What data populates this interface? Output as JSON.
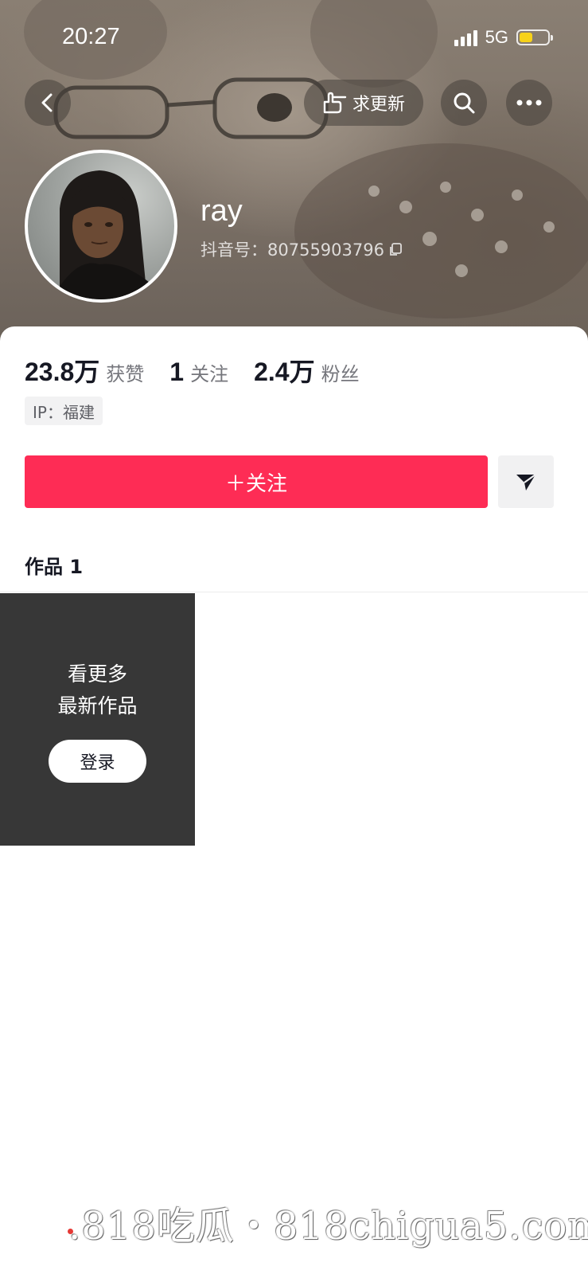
{
  "status_bar": {
    "time": "20:27",
    "network": "5G"
  },
  "header": {
    "request_update_label": "求更新",
    "back_icon": "chevron-left-icon",
    "search_icon": "search-icon",
    "more_icon": "more-icon"
  },
  "profile": {
    "username": "ray",
    "douyin_id": "抖音号：80755903796",
    "copy_icon": "copy-icon"
  },
  "stats": {
    "likes_value": "23.8万",
    "likes_label": "获赞",
    "following_value": "1",
    "following_label": "关注",
    "followers_value": "2.4万",
    "followers_label": "粉丝"
  },
  "ip_tag": "IP：福建",
  "actions": {
    "follow_label": "＋关注",
    "share_icon": "send-icon"
  },
  "works_tab": "作品 1",
  "login_prompt": {
    "line1": "看更多",
    "line2": "最新作品",
    "button": "登录"
  },
  "watermark": ".818吃瓜・818chigua5.com",
  "colors": {
    "accent": "#fe2c55",
    "tile_dark": "#373737",
    "battery": "#f7d21a"
  }
}
